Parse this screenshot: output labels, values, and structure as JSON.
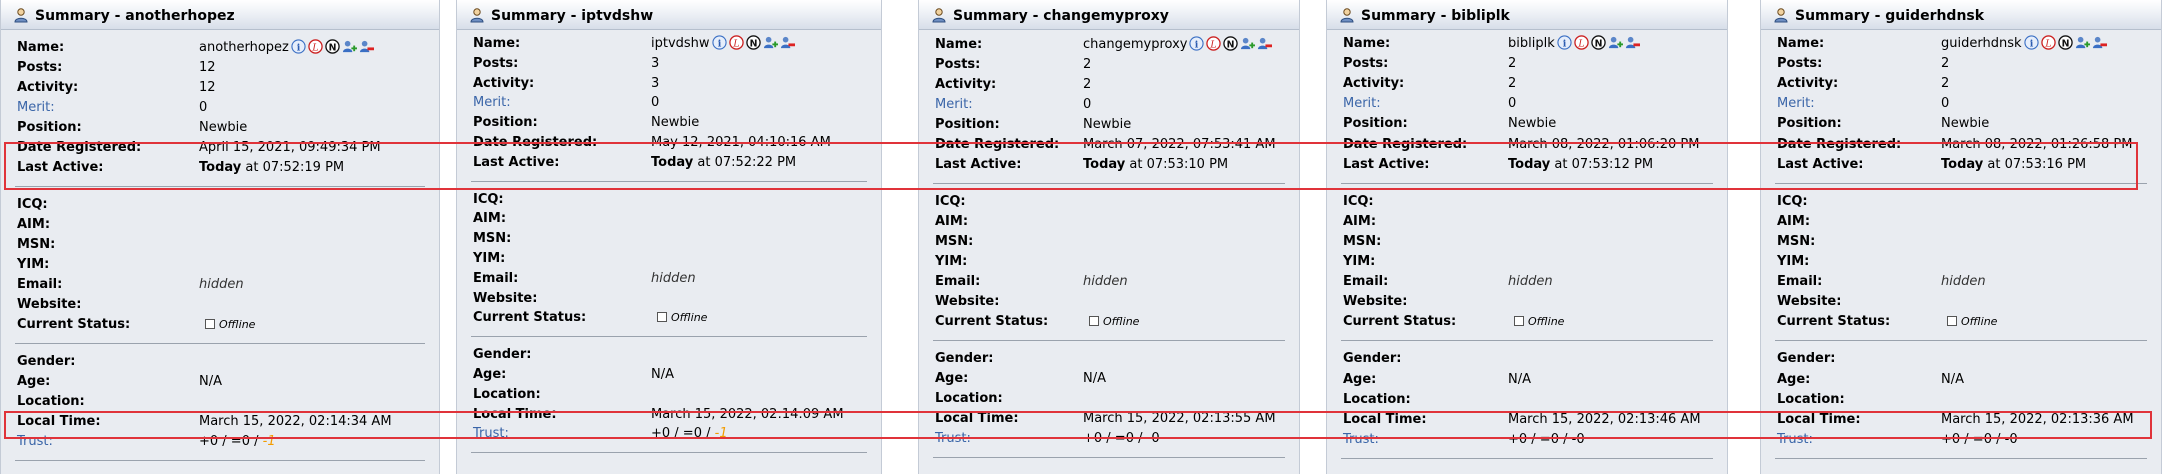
{
  "labels": {
    "name": "Name:",
    "posts": "Posts:",
    "activity": "Activity:",
    "merit": "Merit:",
    "position": "Position:",
    "date_registered": "Date Registered:",
    "last_active": "Last Active:",
    "icq": "ICQ:",
    "aim": "AIM:",
    "msn": "MSN:",
    "yim": "YIM:",
    "email": "Email:",
    "website": "Website:",
    "current_status": "Current Status:",
    "gender": "Gender:",
    "age": "Age:",
    "location": "Location:",
    "local_time": "Local Time:",
    "trust": "Trust:",
    "today": "Today"
  },
  "profiles": [
    {
      "title": "Summary - anotherhopez",
      "name": "anotherhopez",
      "posts": "12",
      "activity": "12",
      "merit": "0",
      "position": "Newbie",
      "date_registered": "April 15, 2021, 09:49:34 PM",
      "last_active_time": " at 07:52:19 PM",
      "email": "hidden",
      "status": "Offline",
      "age": "N/A",
      "local_time": "March 15, 2022, 02:14:34 AM",
      "trust_pos_neutral": "+0 / =0 / ",
      "trust_neg": "-1"
    },
    {
      "title": "Summary - iptvdshw",
      "name": "iptvdshw",
      "posts": "3",
      "activity": "3",
      "merit": "0",
      "position": "Newbie",
      "date_registered": "May 12, 2021, 04:10:16 AM",
      "last_active_time": " at 07:52:22 PM",
      "email": "hidden",
      "status": "Offline",
      "age": "N/A",
      "local_time": "March 15, 2022, 02:14:09 AM",
      "trust_pos_neutral": "+0 / =0 / ",
      "trust_neg": "-1"
    },
    {
      "title": "Summary - changemyproxy",
      "name": "changemyproxy",
      "posts": "2",
      "activity": "2",
      "merit": "0",
      "position": "Newbie",
      "date_registered": "March 07, 2022, 07:53:41 AM",
      "last_active_time": " at 07:53:10 PM",
      "email": "hidden",
      "status": "Offline",
      "age": "N/A",
      "local_time": "March 15, 2022, 02:13:55 AM",
      "trust_pos_neutral": "+0 / =0 / ",
      "trust_neg": "-0"
    },
    {
      "title": "Summary - bibliplk",
      "name": "bibliplk",
      "posts": "2",
      "activity": "2",
      "merit": "0",
      "position": "Newbie",
      "date_registered": "March 08, 2022, 01:06:20 PM",
      "last_active_time": " at 07:53:12 PM",
      "email": "hidden",
      "status": "Offline",
      "age": "N/A",
      "local_time": "March 15, 2022, 02:13:46 AM",
      "trust_pos_neutral": "+0 / =0 / ",
      "trust_neg": "-0"
    },
    {
      "title": "Summary - guiderhdnsk",
      "name": "guiderhdnsk",
      "posts": "2",
      "activity": "2",
      "merit": "0",
      "position": "Newbie",
      "date_registered": "March 08, 2022, 01:26:58 PM",
      "last_active_time": " at 07:53:16 PM",
      "email": "hidden",
      "status": "Offline",
      "age": "N/A",
      "local_time": "March 15, 2022, 02:13:36 AM",
      "trust_pos_neutral": "+0 / =0 / ",
      "trust_neg": "-0"
    }
  ],
  "colors": {
    "panel_bg": "#e9ecf1",
    "highlight": "#e0333a",
    "merit_trust_label": "#3a65a8",
    "negative_trust_highlight": "#f39c00"
  },
  "icon_names": [
    "user-summary-icon",
    "info-icon",
    "ignore-icon",
    "notes-icon",
    "add-buddy-icon",
    "remove-buddy-icon"
  ]
}
